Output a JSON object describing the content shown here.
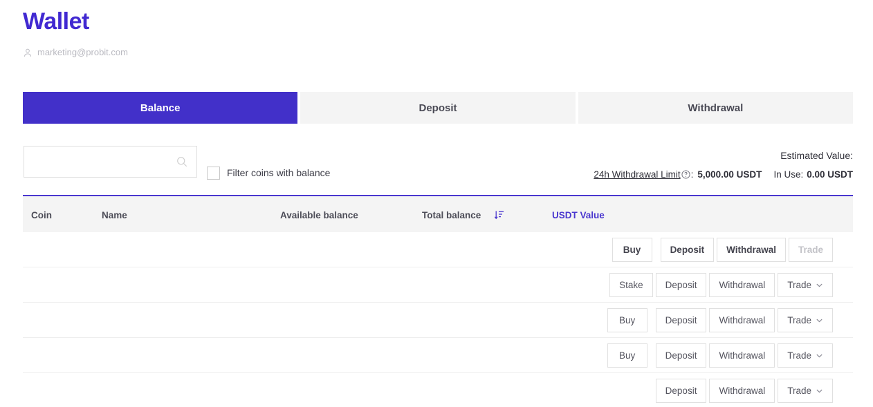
{
  "header": {
    "title": "Wallet",
    "user_icon": "user-icon",
    "email": "marketing@probit.com"
  },
  "tabs": [
    {
      "label": "Balance",
      "active": true
    },
    {
      "label": "Deposit",
      "active": false
    },
    {
      "label": "Withdrawal",
      "active": false
    }
  ],
  "filters": {
    "search_value": "",
    "search_placeholder": "",
    "search_icon": "search-icon",
    "checkbox_checked": false,
    "checkbox_label": "Filter coins with balance"
  },
  "summary": {
    "estimated_value_label": "Estimated Value:",
    "limit_label": "24h Withdrawal Limit",
    "help_icon": "question-circle-icon",
    "limit_colon": ":",
    "limit_value": "5,000.00 USDT",
    "in_use_label": "In Use:",
    "in_use_value": "0.00 USDT"
  },
  "table": {
    "accent_color": "#4a37cf",
    "columns": {
      "coin": "Coin",
      "name": "Name",
      "available": "Available balance",
      "total": "Total balance",
      "sort_icon": "sort-descending-icon",
      "usdt_value": "USDT Value"
    },
    "rows": [
      {
        "buy": "Buy",
        "buy_visible": true,
        "stake": "",
        "stake_visible": false,
        "deposit": "Deposit",
        "withdrawal": "Withdrawal",
        "trade": "Trade",
        "trade_disabled": true,
        "bold": true
      },
      {
        "buy": "",
        "buy_visible": false,
        "stake": "Stake",
        "stake_visible": true,
        "deposit": "Deposit",
        "withdrawal": "Withdrawal",
        "trade": "Trade",
        "trade_disabled": false,
        "bold": false
      },
      {
        "buy": "Buy",
        "buy_visible": true,
        "stake": "",
        "stake_visible": false,
        "deposit": "Deposit",
        "withdrawal": "Withdrawal",
        "trade": "Trade",
        "trade_disabled": false,
        "bold": false
      },
      {
        "buy": "Buy",
        "buy_visible": true,
        "stake": "",
        "stake_visible": false,
        "deposit": "Deposit",
        "withdrawal": "Withdrawal",
        "trade": "Trade",
        "trade_disabled": false,
        "bold": false
      },
      {
        "buy": "",
        "buy_visible": false,
        "stake": "",
        "stake_visible": false,
        "deposit": "Deposit",
        "withdrawal": "Withdrawal",
        "trade": "Trade",
        "trade_disabled": false,
        "bold": false
      }
    ]
  },
  "colors": {
    "brand_purple": "#4129d1",
    "tab_active": "#4230c9",
    "table_accent": "#4a37cf",
    "tab_inactive_bg": "#f4f4f4"
  }
}
